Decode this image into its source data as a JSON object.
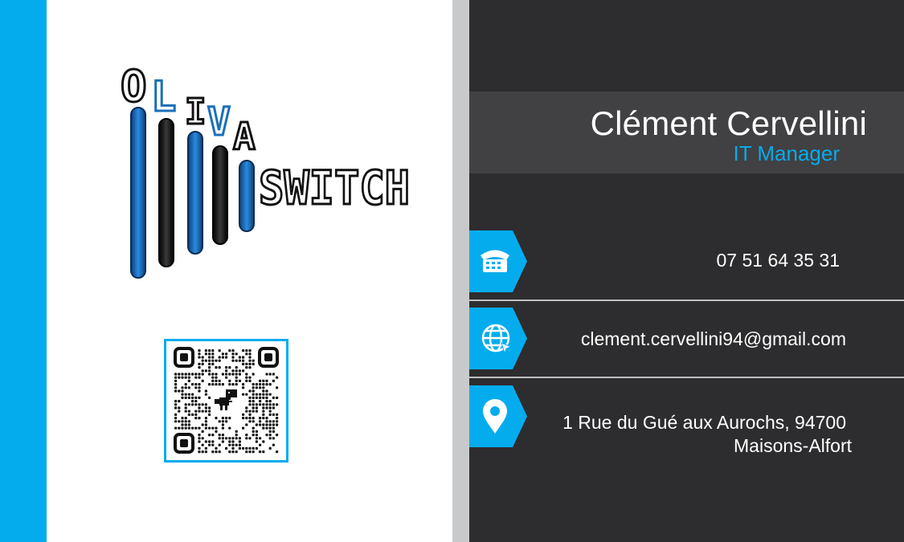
{
  "brand": {
    "logo_name": "Oliva Switch",
    "logo_letters_top": [
      "O",
      "L",
      "I",
      "V",
      "A"
    ],
    "logo_word_bottom": "SWITCH",
    "colors": {
      "accent": "#05aced",
      "logo_blue": "#1b6fb8",
      "logo_dark": "#111111",
      "dark_panel": "#2d2c2e",
      "name_band": "#414042"
    }
  },
  "qr": {
    "icon": "dino-icon"
  },
  "card": {
    "name": "Clément Cervellini",
    "role": "IT Manager"
  },
  "contact": {
    "phone": {
      "icon": "phone-icon",
      "value": "07 51 64 35 31"
    },
    "email": {
      "icon": "globe-icon",
      "value": "clement.cervellini94@gmail.com"
    },
    "address": {
      "icon": "location-pin-icon",
      "line1": "1 Rue du Gué aux Aurochs, 94700",
      "line2": "Maisons-Alfort"
    }
  }
}
